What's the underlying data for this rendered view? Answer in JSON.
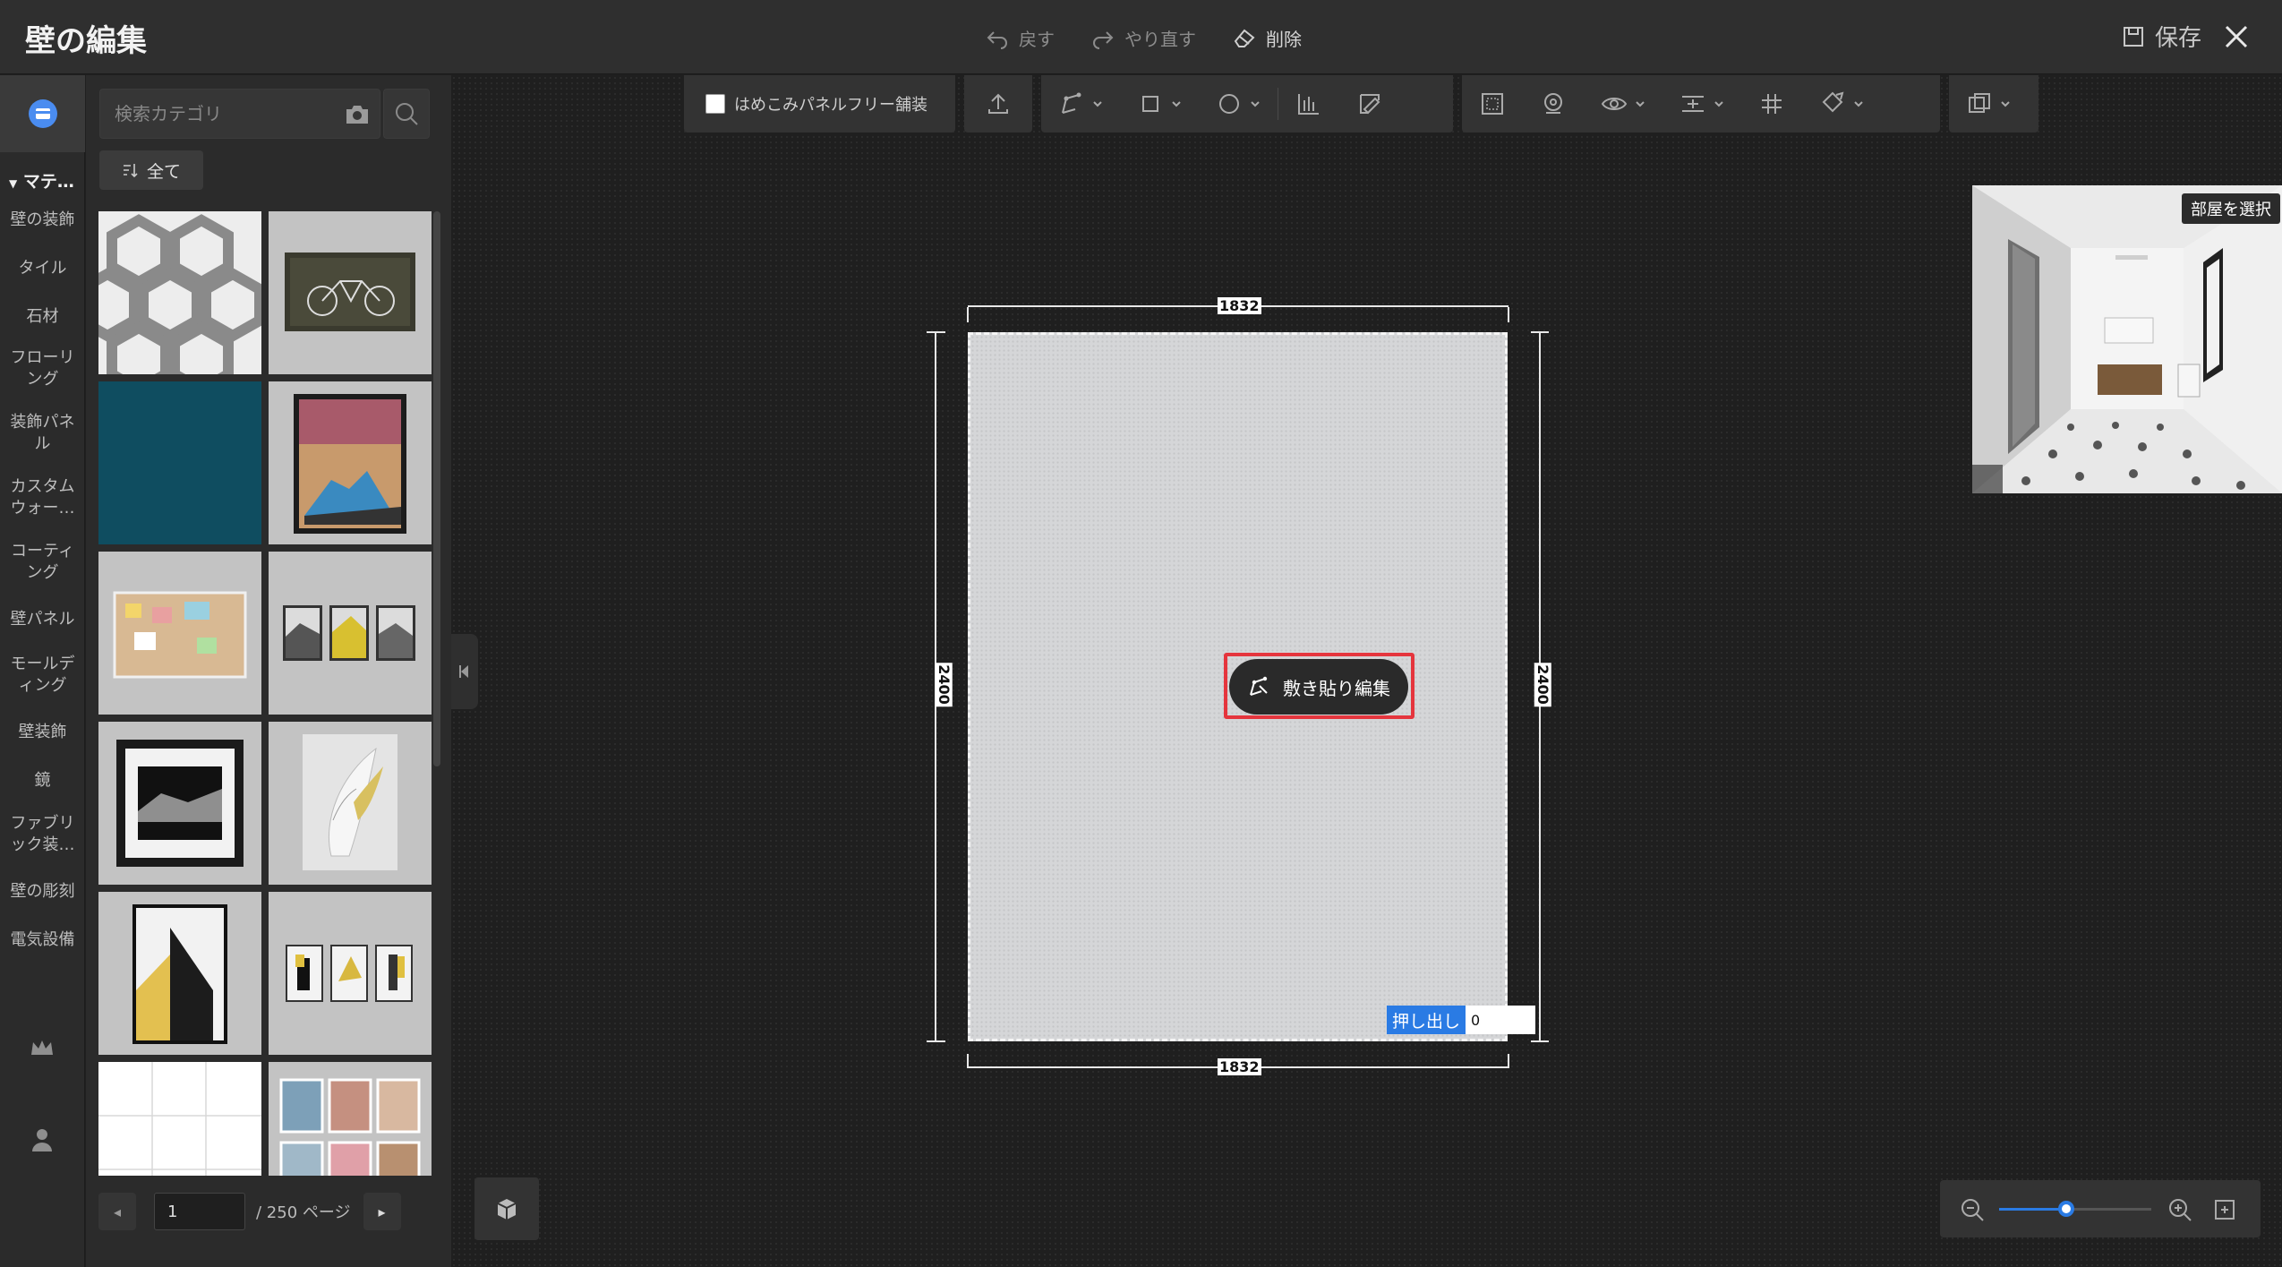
{
  "header": {
    "title": "壁の編集",
    "undo_label": "戻す",
    "redo_label": "やり直す",
    "delete_label": "削除",
    "save_label": "保存"
  },
  "rail": {
    "category_header": "マテ…",
    "categories": [
      "壁の装飾",
      "タイル",
      "石材",
      "フローリング",
      "装飾パネル",
      "カスタムウォー…",
      "コーティング",
      "壁パネル",
      "モールディング",
      "壁装飾",
      "鏡",
      "ファブリック装…",
      "壁の彫刻",
      "電気設備"
    ]
  },
  "panel": {
    "search_placeholder": "検索カテゴリ",
    "filter_label": "全て",
    "page_value": "1",
    "page_total": "/ 250 ページ"
  },
  "toolbar": {
    "inlay_checkbox_label": "はめこみパネルフリー舗装"
  },
  "wall": {
    "width_top": "1832",
    "width_bottom": "1832",
    "height_left": "2400",
    "height_right": "2400",
    "tile_edit_label": "敷き貼り編集",
    "extrude_label": "押し出し",
    "extrude_value": "0"
  },
  "preview": {
    "room_select_label": "部屋を選択"
  },
  "zoom": {
    "level": 0.44
  },
  "colors": {
    "accent": "#2a7be4",
    "highlight": "#e5353d",
    "rail_active": "#4a8cf0"
  }
}
